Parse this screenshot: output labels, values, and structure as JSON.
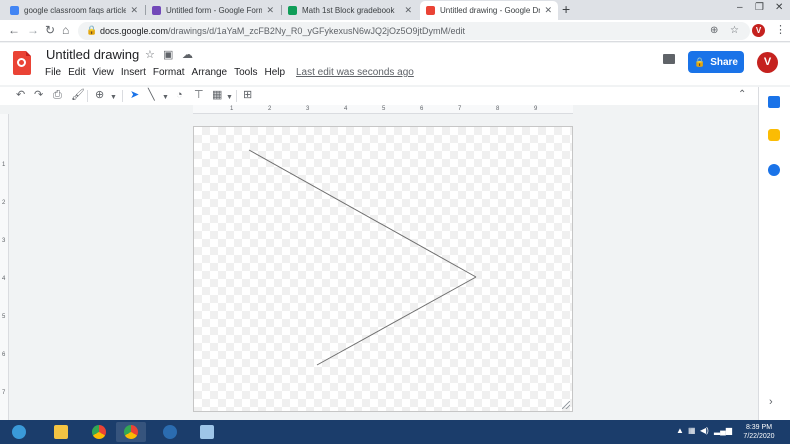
{
  "browser": {
    "tabs": [
      {
        "title": "google classroom faqs article.do",
        "color": "#4285f4"
      },
      {
        "title": "Untitled form - Google Forms",
        "color": "#7248b9"
      },
      {
        "title": "Math 1st Block gradebook",
        "color": "#0f9d58"
      },
      {
        "title": "Untitled drawing - Google Draw",
        "color": "#ea4335"
      }
    ],
    "active_tab": 3,
    "url_host": "docs.google.com",
    "url_path": "/drawings/d/1aYaM_zcFB2Ny_R0_yGFykexusN6wJQ2jOz5O9jtDymM/edit",
    "profile_initial": "V"
  },
  "doc": {
    "title": "Untitled drawing",
    "menus": [
      "File",
      "Edit",
      "View",
      "Insert",
      "Format",
      "Arrange",
      "Tools",
      "Help"
    ],
    "last_edit": "Last edit was seconds ago",
    "share_label": "Share",
    "profile_initial": "V"
  },
  "ruler": {
    "h_labels": [
      "1",
      "2",
      "3",
      "4",
      "5",
      "6",
      "7",
      "8",
      "9"
    ],
    "v_labels": [
      "1",
      "2",
      "3",
      "4",
      "5",
      "6",
      "7"
    ]
  },
  "taskbar": {
    "time": "8:39 PM",
    "date": "7/22/2020"
  }
}
